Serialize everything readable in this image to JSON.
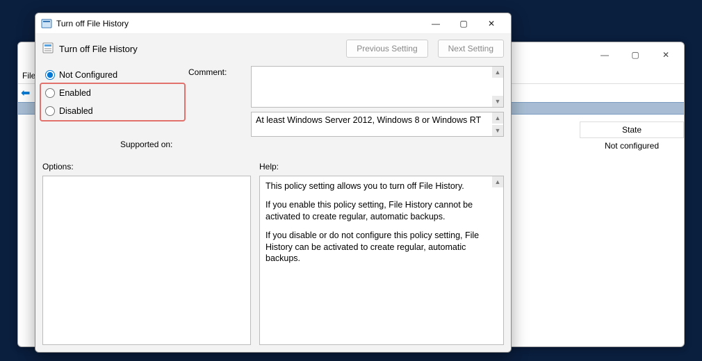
{
  "parent": {
    "menu_file": "File",
    "state_header": "State",
    "state_value": "Not configured"
  },
  "dialog": {
    "title": "Turn off File History",
    "subtitle": "Turn off File History",
    "prev_btn": "Previous Setting",
    "next_btn": "Next Setting",
    "radios": {
      "not_configured": "Not Configured",
      "enabled": "Enabled",
      "disabled": "Disabled"
    },
    "comment_label": "Comment:",
    "supported_label": "Supported on:",
    "supported_text": "At least Windows Server 2012, Windows 8 or Windows RT",
    "options_label": "Options:",
    "help_label": "Help:",
    "help_body": {
      "p1": "This policy setting allows you to turn off File History.",
      "p2": "If you enable this policy setting, File History cannot be activated to create regular, automatic backups.",
      "p3": "If you disable or do not configure this policy setting, File History can be activated to create regular, automatic backups."
    }
  }
}
